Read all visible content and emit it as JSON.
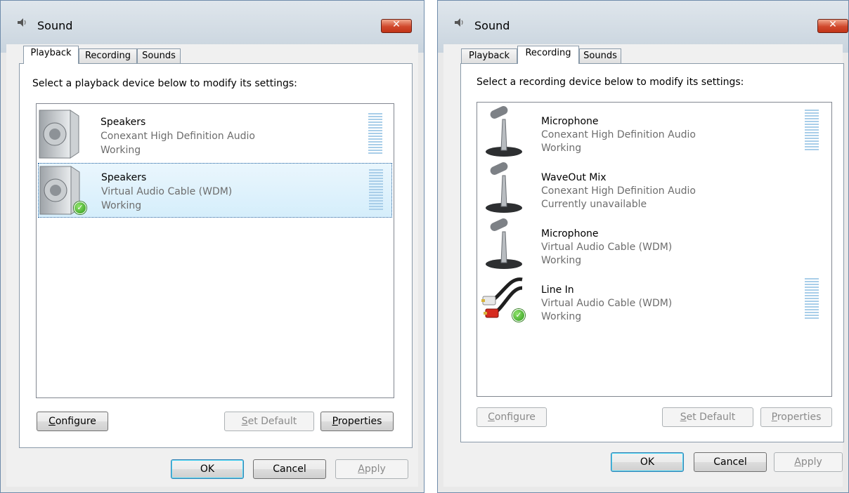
{
  "dialogs": [
    {
      "title": "Sound",
      "tabs": [
        "Playback",
        "Recording",
        "Sounds"
      ],
      "active_tab": "Playback",
      "instruction": "Select a playback device below to modify its settings:",
      "devices": [
        {
          "name": "Speakers",
          "driver": "Conexant High Definition Audio",
          "status": "Working",
          "icon": "speaker-icon",
          "selected": false,
          "default": false
        },
        {
          "name": "Speakers",
          "driver": "Virtual Audio Cable (WDM)",
          "status": "Working",
          "icon": "speaker-icon",
          "selected": true,
          "default": true
        }
      ],
      "buttons": {
        "configure": {
          "accel": "C",
          "rest": "onfigure"
        },
        "set_default": {
          "accel": "S",
          "rest": "et Default"
        },
        "properties": {
          "accel": "P",
          "rest": "roperties"
        },
        "ok": "OK",
        "cancel": "Cancel",
        "apply": {
          "accel": "A",
          "rest": "pply"
        }
      }
    },
    {
      "title": "Sound",
      "tabs": [
        "Playback",
        "Recording",
        "Sounds"
      ],
      "active_tab": "Recording",
      "instruction": "Select a recording device below to modify its settings:",
      "devices": [
        {
          "name": "Microphone",
          "driver": "Conexant High Definition Audio",
          "status": "Working",
          "icon": "microphone-icon",
          "default": false
        },
        {
          "name": "WaveOut Mix",
          "driver": "Conexant High Definition Audio",
          "status": "Currently unavailable",
          "icon": "microphone-icon",
          "default": false
        },
        {
          "name": "Microphone",
          "driver": "Virtual Audio Cable (WDM)",
          "status": "Working",
          "icon": "microphone-icon",
          "default": false
        },
        {
          "name": "Line In",
          "driver": "Virtual Audio Cable (WDM)",
          "status": "Working",
          "icon": "rca-cable-icon",
          "default": true
        }
      ],
      "buttons": {
        "configure": {
          "accel": "C",
          "rest": "onfigure"
        },
        "set_default": {
          "accel": "S",
          "rest": "et Default"
        },
        "properties": {
          "accel": "P",
          "rest": "roperties"
        },
        "ok": "OK",
        "cancel": "Cancel",
        "apply": {
          "accel": "A",
          "rest": "pply"
        }
      }
    }
  ],
  "colors": {
    "selection": "#d5eefb",
    "meter": "#a9cee9",
    "secondary_text": "#6d6d6d",
    "close_button": "#c23418"
  }
}
